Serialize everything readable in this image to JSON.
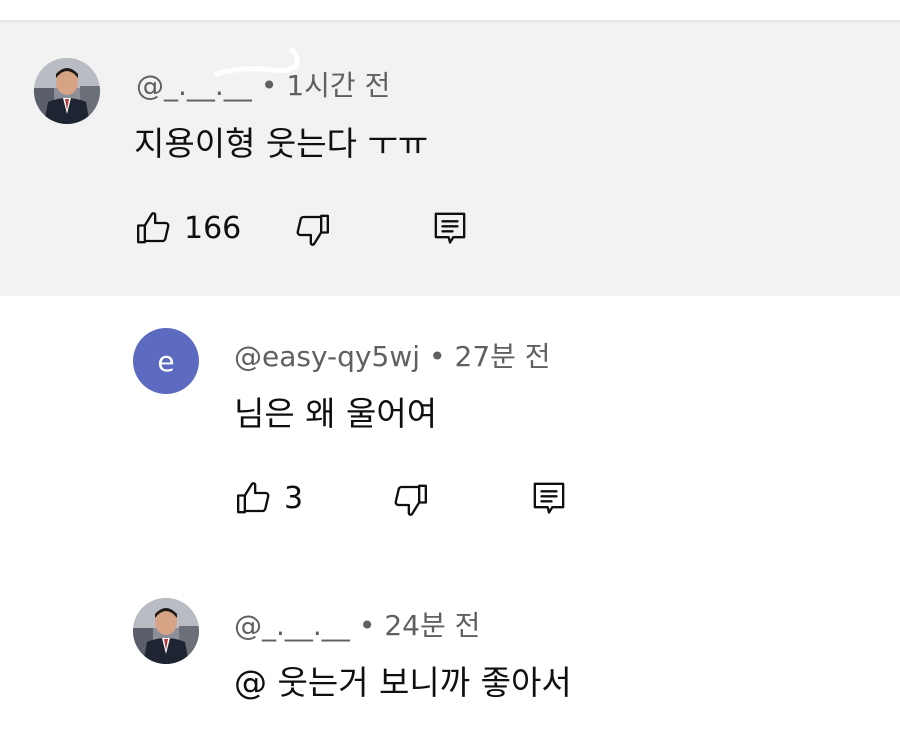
{
  "comments": [
    {
      "handle": "@_.__.__",
      "separator": "•",
      "time": "1시간 전",
      "text": "지용이형 웃는다 ㅜㅠ",
      "likes": "166"
    },
    {
      "handle": "@easy-qy5wj",
      "separator": "•",
      "time": "27분 전",
      "text": "님은 왜 울어여",
      "likes": "3",
      "avatar_letter": "e"
    },
    {
      "handle": "@_.__.__",
      "separator": "•",
      "time": "24분 전",
      "text": "@ 웃는거 보니까 좋아서"
    }
  ],
  "icons": {
    "like": "thumbs-up-icon",
    "dislike": "thumbs-down-icon",
    "reply": "reply-comment-icon"
  },
  "colors": {
    "highlight_bg": "#f2f2f2",
    "meta_text": "#606060",
    "avatar_letter_bg": "#5c6bc0"
  }
}
